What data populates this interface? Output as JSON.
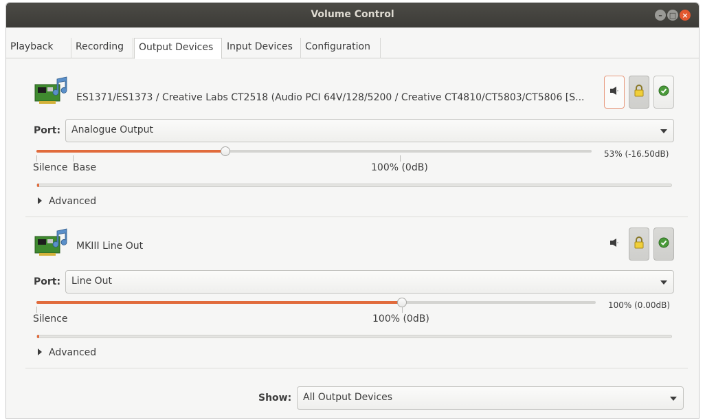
{
  "window": {
    "title": "Volume Control",
    "controls": [
      "minimize-icon",
      "maximize-icon",
      "close-icon"
    ]
  },
  "tabs": [
    {
      "label": "Playback",
      "active": false
    },
    {
      "label": "Recording",
      "active": false
    },
    {
      "label": "Output Devices",
      "active": true
    },
    {
      "label": "Input Devices",
      "active": false
    },
    {
      "label": "Configuration",
      "active": false
    }
  ],
  "devices": [
    {
      "name": "ES1371/ES1373 / Creative Labs CT2518 (Audio PCI 64V/128/5200 / Creative CT4810/CT5803/CT5806 [S...",
      "port_label": "Port:",
      "port_value": "Analogue Output",
      "volume_fraction": 0.34,
      "volume_readout": "53% (-16.50dB)",
      "marks": [
        "Silence",
        "Base",
        "100% (0dB)"
      ],
      "meter_fraction": 0.003,
      "advanced_label": "Advanced",
      "mute_state": "highlighted"
    },
    {
      "name": "MKIII Line Out",
      "port_label": "Port:",
      "port_value": "Line Out",
      "volume_fraction": 0.654,
      "volume_readout": "100% (0.00dB)",
      "marks": [
        "Silence",
        "100% (0dB)"
      ],
      "meter_fraction": 0.003,
      "advanced_label": "Advanced",
      "mute_state": "normal"
    }
  ],
  "footer": {
    "show_label": "Show:",
    "show_value": "All Output Devices"
  },
  "colors": {
    "accent": "#e16b3c",
    "titlebar": "#3c3b37",
    "close": "#e3582f"
  },
  "icons": [
    "sound-card-icon",
    "speaker-icon",
    "lock-icon",
    "checkmark-icon"
  ]
}
